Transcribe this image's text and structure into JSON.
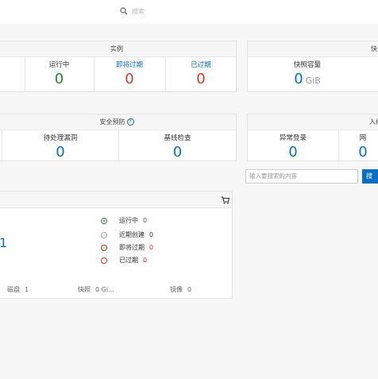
{
  "search": {
    "placeholder": "搜索"
  },
  "instances_panel": {
    "title": "实例",
    "cells": [
      {
        "label": "运行中",
        "value": "0"
      },
      {
        "label": "即将过期",
        "value": "0"
      },
      {
        "label": "已过期",
        "value": "0"
      }
    ]
  },
  "snapshot_panel": {
    "title_partial": "快",
    "label": "快照容量",
    "value": "0",
    "unit": "GiB"
  },
  "security_panel": {
    "title": "安全预防",
    "cells": [
      {
        "label": "待处理漏洞",
        "value": "0"
      },
      {
        "label": "基线检查",
        "value": "0"
      }
    ]
  },
  "intrusion_panel": {
    "title_partial": "入侵",
    "cells": [
      {
        "label": "异常登录",
        "value": "0"
      },
      {
        "label": "网",
        "value": "0"
      }
    ]
  },
  "resource_search": {
    "placeholder": "输入要搜索的内容",
    "button_label": "搜"
  },
  "region_card": {
    "count_partial": "1",
    "status": [
      {
        "label": "运行中",
        "value": "0",
        "color": "#2a8a2a"
      },
      {
        "label": "近期创建",
        "value": "0",
        "color": "#999999"
      },
      {
        "label": "即将过期",
        "value": "0",
        "color": "#d9362b"
      },
      {
        "label": "已过期",
        "value": "0",
        "color": "#d9362b"
      }
    ],
    "footer": [
      {
        "label": "磁盘",
        "value": "1"
      },
      {
        "label": "快照",
        "value": "0 Gi..."
      },
      {
        "label": "镜像",
        "value": "0"
      }
    ]
  }
}
